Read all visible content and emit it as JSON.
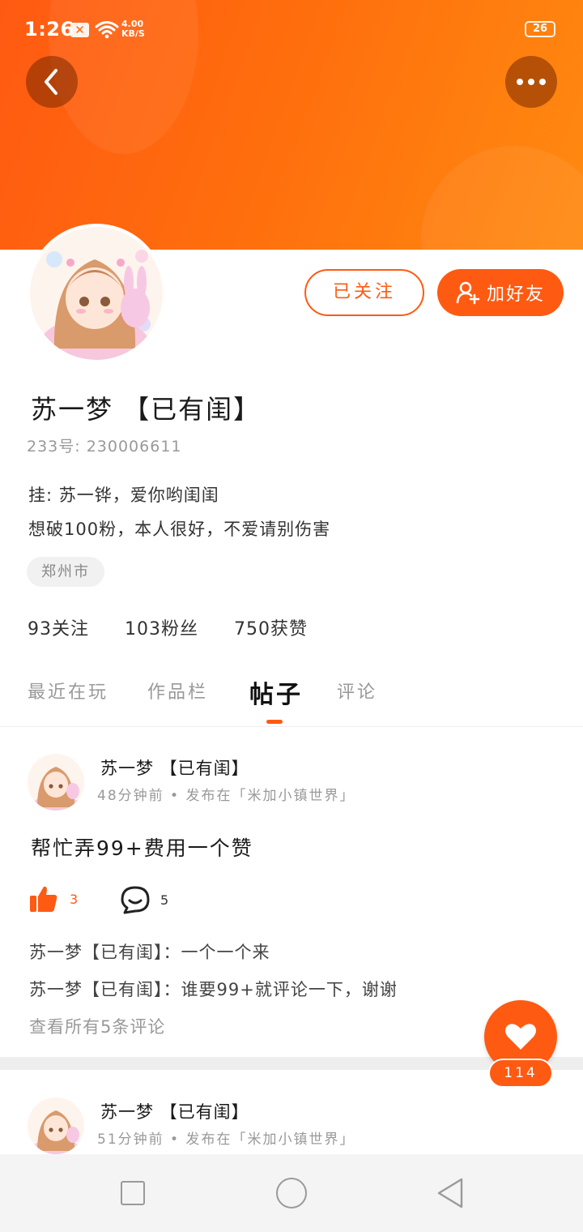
{
  "status_bar": {
    "time": "1:26",
    "speed_top": "4.00",
    "speed_bottom": "KB/S",
    "battery": "26"
  },
  "header": {
    "back_icon": "chevron-left-icon",
    "more_icon": "more-dots-icon"
  },
  "profile": {
    "followed_label": "已关注",
    "add_friend_label": "加好友",
    "name": "苏一梦 【已有闺】",
    "id_line": "233号: 230006611",
    "bio_line1": "挂: 苏一铧，爱你哟闺闺",
    "bio_line2": "想破100粉，本人很好，不爱请别伤害",
    "location": "郑州市",
    "stats": [
      {
        "label": "93关注"
      },
      {
        "label": "103粉丝"
      },
      {
        "label": "750获赞"
      }
    ]
  },
  "tabs": [
    {
      "label": "最近在玩"
    },
    {
      "label": "作品栏"
    },
    {
      "label": "帖子"
    },
    {
      "label": "评论"
    }
  ],
  "active_tab": "帖子",
  "posts": [
    {
      "author": "苏一梦 【已有闺】",
      "meta": "48分钟前 • 发布在「米加小镇世界」",
      "title": "帮忙弄99+费用一个赞",
      "likes": "3",
      "comments": "5",
      "comment_lines": [
        "苏一梦【已有闺】：一个一个来",
        "苏一梦【已有闺】：谁要99+就评论一下，谢谢"
      ],
      "view_all": "查看所有5条评论"
    },
    {
      "author": "苏一梦 【已有闺】",
      "meta": "51分钟前 • 发布在「米加小镇世界」"
    }
  ],
  "fab": {
    "count": "114",
    "icon": "heart-icon"
  },
  "colors": {
    "accent": "#ff5a12",
    "header_gradient_end": "#ff8a10"
  }
}
